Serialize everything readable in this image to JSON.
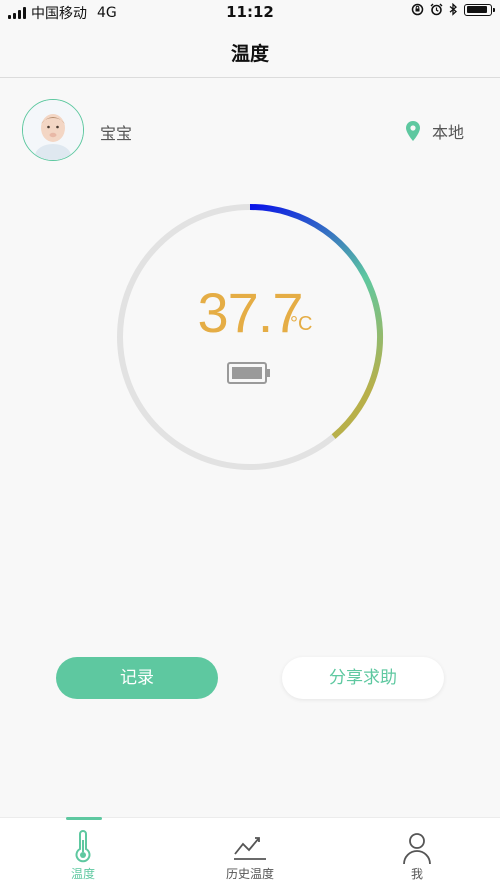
{
  "status_bar": {
    "carrier": "中国移动",
    "network": "4G",
    "time": "11:12",
    "battery_level": 0.8
  },
  "nav": {
    "title": "温度"
  },
  "profile": {
    "name": "宝宝",
    "location": "本地"
  },
  "gauge": {
    "temperature": "37.7",
    "unit": "°C",
    "arc_colors": [
      "#0a14e8",
      "#5ec8a0",
      "#b8b04a"
    ],
    "track_color": "#e2e2e2",
    "value_color": "#e5ad45"
  },
  "actions": {
    "record": "记录",
    "share": "分享求助"
  },
  "tabs": [
    {
      "label": "温度",
      "icon": "thermometer-icon",
      "active": true
    },
    {
      "label": "历史温度",
      "icon": "trend-chart-icon",
      "active": false
    },
    {
      "label": "我",
      "icon": "person-icon",
      "active": false
    }
  ],
  "colors": {
    "accent": "#5ec8a0"
  }
}
